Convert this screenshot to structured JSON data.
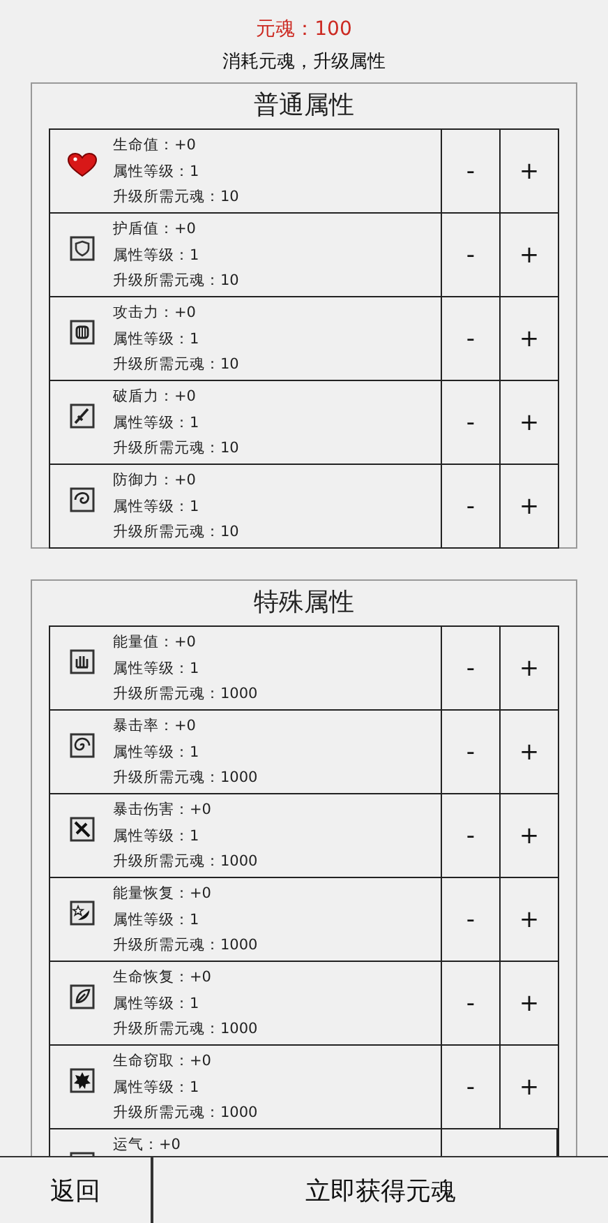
{
  "soul": "元魂：100",
  "subtitle": "消耗元魂，升级属性",
  "panels": [
    {
      "title": "普通属性",
      "rows": [
        {
          "lines": [
            "生命值：+0",
            "属性等级：1",
            "升级所需元魂：10"
          ],
          "buttons": [
            "-",
            "+"
          ]
        },
        {
          "lines": [
            "护盾值：+0",
            "属性等级：1",
            "升级所需元魂：10"
          ],
          "buttons": [
            "-",
            "+"
          ]
        },
        {
          "lines": [
            "攻击力：+0",
            "属性等级：1",
            "升级所需元魂：10"
          ],
          "buttons": [
            "-",
            "+"
          ]
        },
        {
          "lines": [
            "破盾力：+0",
            "属性等级：1",
            "升级所需元魂：10"
          ],
          "buttons": [
            "-",
            "+"
          ]
        },
        {
          "lines": [
            "防御力：+0",
            "属性等级：1",
            "升级所需元魂：10"
          ],
          "buttons": [
            "-",
            "+"
          ]
        }
      ]
    },
    {
      "title": "特殊属性",
      "rows": [
        {
          "lines": [
            "能量值：+0",
            "属性等级：1",
            "升级所需元魂：1000"
          ],
          "buttons": [
            "-",
            "+"
          ]
        },
        {
          "lines": [
            "暴击率：+0",
            "属性等级：1",
            "升级所需元魂：1000"
          ],
          "buttons": [
            "-",
            "+"
          ]
        },
        {
          "lines": [
            "暴击伤害：+0",
            "属性等级：1",
            "升级所需元魂：1000"
          ],
          "buttons": [
            "-",
            "+"
          ]
        },
        {
          "lines": [
            "能量恢复：+0",
            "属性等级：1",
            "升级所需元魂：1000"
          ],
          "buttons": [
            "-",
            "+"
          ]
        },
        {
          "lines": [
            "生命恢复：+0",
            "属性等级：1",
            "升级所需元魂：1000"
          ],
          "buttons": [
            "-",
            "+"
          ]
        },
        {
          "lines": [
            "生命窃取：+0",
            "属性等级：1",
            "升级所需元魂：1000"
          ],
          "buttons": [
            "-",
            "+"
          ]
        },
        {
          "lines": [
            "运气：+0"
          ],
          "buttons": []
        }
      ]
    }
  ],
  "footer": {
    "back": "返回",
    "get": "立即获得元魂"
  }
}
